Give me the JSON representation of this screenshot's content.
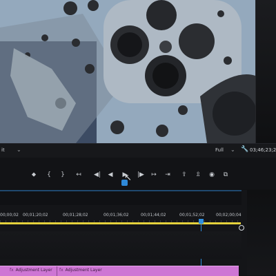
{
  "viewer": {
    "fit_label": "it",
    "zoom_label": "Full",
    "timecode": "03;46;23;2"
  },
  "transport": {
    "buttons": [
      {
        "name": "add-marker-button",
        "glyph": "⬥"
      },
      {
        "name": "mark-in-button",
        "glyph": "{"
      },
      {
        "name": "mark-out-button",
        "glyph": "}"
      },
      {
        "name": "go-to-in-button",
        "glyph": "↤"
      },
      {
        "name": "step-back-button",
        "glyph": "◀|"
      },
      {
        "name": "play-button",
        "glyph": "▶"
      },
      {
        "name": "step-forward-button",
        "glyph": "|▶"
      },
      {
        "name": "go-to-out-button",
        "glyph": "↦"
      },
      {
        "name": "lift-button",
        "glyph": "⇪"
      },
      {
        "name": "extract-button",
        "glyph": "⇫"
      },
      {
        "name": "export-frame-button",
        "glyph": "◉"
      },
      {
        "name": "compare-button",
        "glyph": "⧉"
      }
    ]
  },
  "timeline": {
    "ruler": [
      "00;00;02",
      "00;01;20;02",
      "00;01;28;02",
      "00;01;36;02",
      "00;01;44;02",
      "00;01;52;02",
      "00;02;00;04"
    ],
    "clips": [
      "Adjustment Layer",
      "Adjustment Layer"
    ]
  },
  "colors": {
    "playhead": "#2e8fe0",
    "work_area": "#e4d13c",
    "adjustment_clip": "#ce76d4"
  }
}
